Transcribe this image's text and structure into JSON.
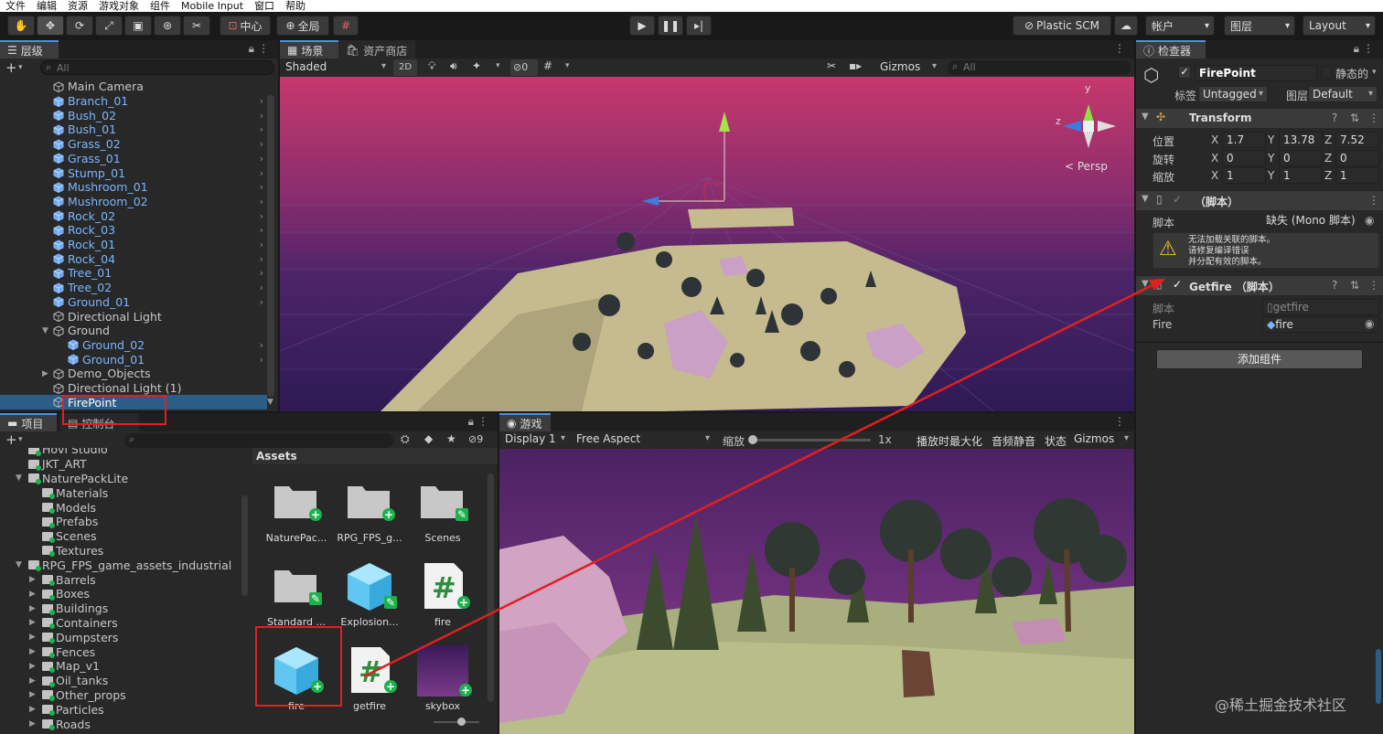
{
  "menu": [
    "文件",
    "编辑",
    "资源",
    "游戏对象",
    "组件",
    "Mobile Input",
    "窗口",
    "帮助"
  ],
  "toolbar": {
    "pivot": "中心",
    "global": "全局",
    "plastic": "Plastic SCM",
    "account": "帐户",
    "layers": "图层",
    "layout": "Layout"
  },
  "hierarchy": {
    "tab": "层级",
    "search_placeholder": "All",
    "items": [
      {
        "name": "Main Camera",
        "prefab": false,
        "indent": 1,
        "arrow": false
      },
      {
        "name": "Branch_01",
        "prefab": true,
        "indent": 1,
        "arrow": false
      },
      {
        "name": "Bush_02",
        "prefab": true,
        "indent": 1,
        "arrow": false
      },
      {
        "name": "Bush_01",
        "prefab": true,
        "indent": 1,
        "arrow": false
      },
      {
        "name": "Grass_02",
        "prefab": true,
        "indent": 1,
        "arrow": false
      },
      {
        "name": "Grass_01",
        "prefab": true,
        "indent": 1,
        "arrow": false
      },
      {
        "name": "Stump_01",
        "prefab": true,
        "indent": 1,
        "arrow": false
      },
      {
        "name": "Mushroom_01",
        "prefab": true,
        "indent": 1,
        "arrow": false
      },
      {
        "name": "Mushroom_02",
        "prefab": true,
        "indent": 1,
        "arrow": false
      },
      {
        "name": "Rock_02",
        "prefab": true,
        "indent": 1,
        "arrow": false
      },
      {
        "name": "Rock_03",
        "prefab": true,
        "indent": 1,
        "arrow": false
      },
      {
        "name": "Rock_01",
        "prefab": true,
        "indent": 1,
        "arrow": false
      },
      {
        "name": "Rock_04",
        "prefab": true,
        "indent": 1,
        "arrow": false
      },
      {
        "name": "Tree_01",
        "prefab": true,
        "indent": 1,
        "arrow": false
      },
      {
        "name": "Tree_02",
        "prefab": true,
        "indent": 1,
        "arrow": false
      },
      {
        "name": "Ground_01",
        "prefab": true,
        "indent": 1,
        "arrow": false
      },
      {
        "name": "Directional Light",
        "prefab": false,
        "indent": 1,
        "arrow": false
      },
      {
        "name": "Ground",
        "prefab": false,
        "indent": 1,
        "arrow": "open"
      },
      {
        "name": "Ground_02",
        "prefab": true,
        "indent": 2,
        "arrow": false
      },
      {
        "name": "Ground_01",
        "prefab": true,
        "indent": 2,
        "arrow": false
      },
      {
        "name": "Demo_Objects",
        "prefab": false,
        "indent": 1,
        "arrow": "closed"
      },
      {
        "name": "Directional Light (1)",
        "prefab": false,
        "indent": 1,
        "arrow": false
      },
      {
        "name": "FirePoint",
        "prefab": false,
        "indent": 1,
        "arrow": false,
        "selected": true
      }
    ]
  },
  "scene": {
    "tab_scene": "场景",
    "tab_store": "资产商店",
    "shading": "Shaded",
    "mode2d": "2D",
    "hidden_count": "0",
    "gizmos": "Gizmos",
    "search_placeholder": "All",
    "persp": "< Persp",
    "axis_y": "y",
    "axis_z": "z"
  },
  "project": {
    "tab_project": "项目",
    "tab_console": "控制台",
    "hidden_count": "9",
    "assets_header": "Assets",
    "tree": [
      {
        "name": "Hovl Studio",
        "indent": 1,
        "arrow": false
      },
      {
        "name": "JKT_ART",
        "indent": 1,
        "arrow": false
      },
      {
        "name": "NaturePackLite",
        "indent": 1,
        "arrow": "open"
      },
      {
        "name": "Materials",
        "indent": 2,
        "arrow": false
      },
      {
        "name": "Models",
        "indent": 2,
        "arrow": false
      },
      {
        "name": "Prefabs",
        "indent": 2,
        "arrow": false
      },
      {
        "name": "Scenes",
        "indent": 2,
        "arrow": false
      },
      {
        "name": "Textures",
        "indent": 2,
        "arrow": false
      },
      {
        "name": "RPG_FPS_game_assets_industrial",
        "indent": 1,
        "arrow": "open"
      },
      {
        "name": "Barrels",
        "indent": 2,
        "arrow": "closed"
      },
      {
        "name": "Boxes",
        "indent": 2,
        "arrow": "closed"
      },
      {
        "name": "Buildings",
        "indent": 2,
        "arrow": "closed"
      },
      {
        "name": "Containers",
        "indent": 2,
        "arrow": "closed"
      },
      {
        "name": "Dumpsters",
        "indent": 2,
        "arrow": "closed"
      },
      {
        "name": "Fences",
        "indent": 2,
        "arrow": "closed"
      },
      {
        "name": "Map_v1",
        "indent": 2,
        "arrow": "closed"
      },
      {
        "name": "Oil_tanks",
        "indent": 2,
        "arrow": "closed"
      },
      {
        "name": "Other_props",
        "indent": 2,
        "arrow": "closed"
      },
      {
        "name": "Particles",
        "indent": 2,
        "arrow": "closed"
      },
      {
        "name": "Roads",
        "indent": 2,
        "arrow": "closed"
      }
    ],
    "assets": [
      {
        "label": "NaturePac...",
        "kind": "folder"
      },
      {
        "label": "RPG_FPS_g...",
        "kind": "folder"
      },
      {
        "label": "Scenes",
        "kind": "folder-scene"
      },
      {
        "label": "Standard ...",
        "kind": "folder-scene"
      },
      {
        "label": "Explosion...",
        "kind": "prefab-edit"
      },
      {
        "label": "fire",
        "kind": "script"
      },
      {
        "label": "fire",
        "kind": "prefab"
      },
      {
        "label": "getfire",
        "kind": "script"
      },
      {
        "label": "skybox",
        "kind": "material"
      }
    ]
  },
  "game": {
    "tab": "游戏",
    "display": "Display 1",
    "aspect": "Free Aspect",
    "scale_label": "缩放",
    "scale_value": "1x",
    "maximize": "播放时最大化",
    "mute": "音频静音",
    "stats": "状态",
    "gizmos": "Gizmos"
  },
  "inspector": {
    "tab": "检查器",
    "object_name": "FirePoint",
    "static_label": "静态的",
    "tag_label": "标签",
    "tag_value": "Untagged",
    "layer_label": "图层",
    "layer_value": "Default",
    "transform_title": "Transform",
    "position_label": "位置",
    "rotation_label": "旋转",
    "scale_label": "缩放",
    "position": {
      "x": "1.7",
      "y": "13.78",
      "z": "7.52"
    },
    "rotation": {
      "x": "0",
      "y": "0",
      "z": "0"
    },
    "scale": {
      "x": "1",
      "y": "1",
      "z": "1"
    },
    "axis_x": "X",
    "axis_y": "Y",
    "axis_z": "Z",
    "missing_title": "（脚本）",
    "script_label": "脚本",
    "missing_value": "缺失 (Mono 脚本)",
    "warning": [
      "无法加载关联的脚本。",
      "请修复编译错误",
      "并分配有效的脚本。"
    ],
    "getfire_title": "Getfire （脚本）",
    "getfire_script_label": "脚本",
    "getfire_script_value": "getfire",
    "fire_label": "Fire",
    "fire_value": "fire",
    "add_component": "添加组件"
  },
  "watermark": "@稀土掘金技术社区",
  "colors": {
    "accent": "#4a90e2",
    "prefab": "#7bb6ff",
    "selection": "#2c5d87",
    "annotation": "#e02020",
    "plus": "#1bb24c"
  }
}
